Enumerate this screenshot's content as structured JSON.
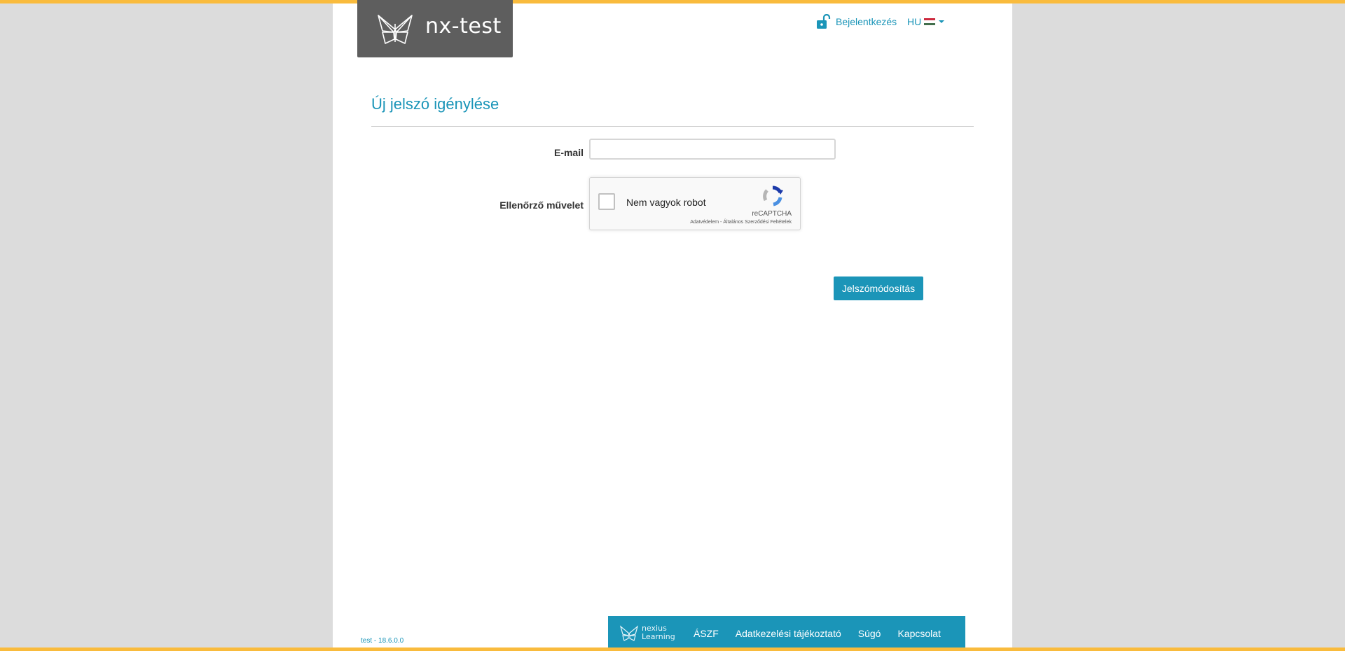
{
  "header": {
    "logo_text": "nx-test",
    "login_label": "Bejelentkezés",
    "language_code": "HU",
    "flag_colors": [
      "#cd2a3e",
      "#ffffff",
      "#436f4d"
    ]
  },
  "main": {
    "title": "Új jelszó igénylése",
    "email_label": "E-mail",
    "email_value": "",
    "captcha_label": "Ellenőrző művelet",
    "captcha": {
      "checkbox_label": "Nem vagyok robot",
      "brand": "reCAPTCHA",
      "links": "Adatvédelem - Általános Szerződési Feltételek"
    },
    "submit_label": "Jelszómódosítás"
  },
  "footer": {
    "version": "test - 18.6.0.0",
    "brand_line1": "nexius",
    "brand_line2": "Learning",
    "links": [
      "ÁSZF",
      "Adatkezelési tájékoztató",
      "Súgó",
      "Kapcsolat"
    ]
  },
  "colors": {
    "accent": "#1b95b8",
    "top_bar": "#f9bb3d",
    "logo_bg": "#5e5e5e"
  }
}
